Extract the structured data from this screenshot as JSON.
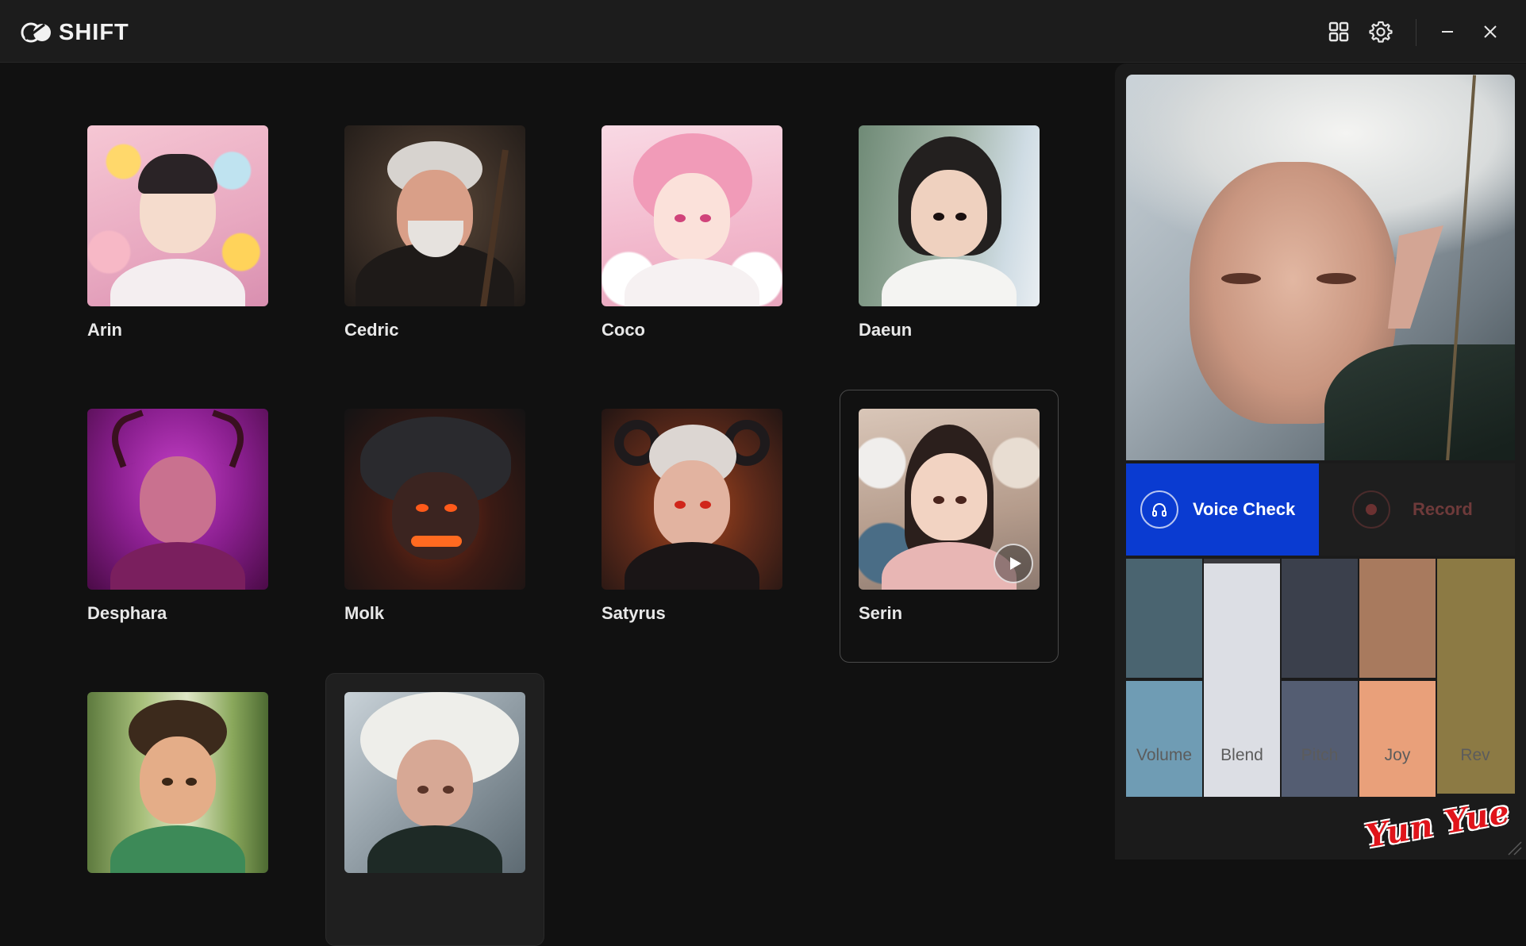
{
  "app": {
    "name": "SHIFT"
  },
  "titlebar": {
    "icons": [
      "grid-view-icon",
      "settings-gear-icon",
      "minimize-icon",
      "close-icon"
    ]
  },
  "characters": [
    {
      "name": "Arin"
    },
    {
      "name": "Cedric"
    },
    {
      "name": "Coco"
    },
    {
      "name": "Daeun"
    },
    {
      "name": "Desphara"
    },
    {
      "name": "Molk"
    },
    {
      "name": "Satyrus"
    },
    {
      "name": "Serin"
    },
    {
      "name": ""
    },
    {
      "name": ""
    }
  ],
  "panel": {
    "voice_check_label": "Voice Check",
    "record_label": "Record",
    "controls": [
      {
        "label": "Volume",
        "top_color": "#4a6470",
        "bottom_color": "#6f9cb4"
      },
      {
        "label": "Blend",
        "top_color": "#dcdee4",
        "bottom_color": "#dcdee4"
      },
      {
        "label": "Pitch",
        "top_color": "#3b404c",
        "bottom_color": "#545d72"
      },
      {
        "label": "Joy",
        "top_color": "#a87a5e",
        "bottom_color": "#e9a07a"
      },
      {
        "label": "Rev",
        "top_color": "#8c7a44",
        "bottom_color": "#8c7a44"
      }
    ]
  },
  "watermark": "Yun Yue",
  "colors": {
    "accent": "#0a3bd1",
    "background": "#111111",
    "panel": "#1b1b1b"
  }
}
